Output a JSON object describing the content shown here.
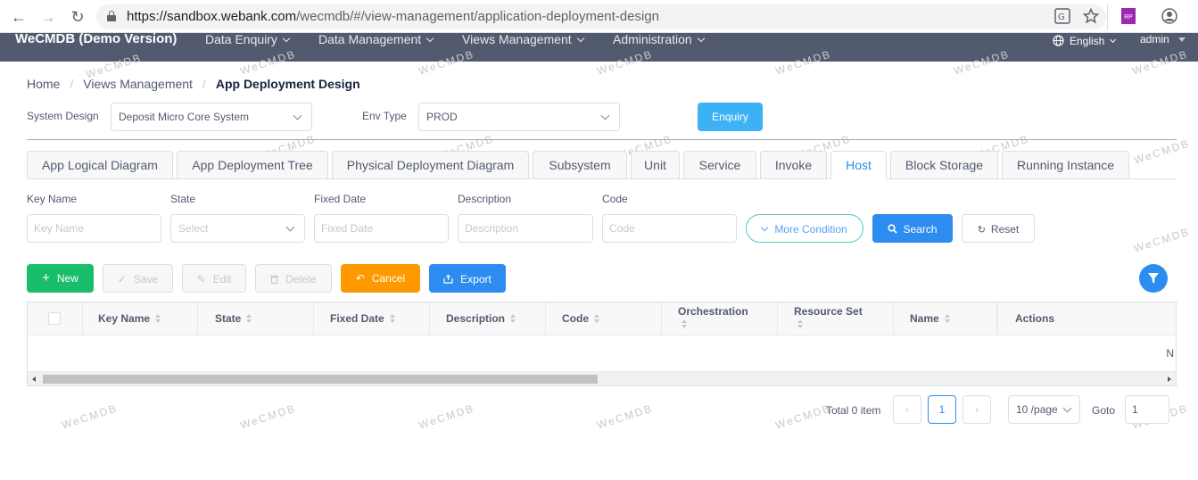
{
  "browser": {
    "url_host": "https://sandbox.webank.com",
    "url_path": "/wecmdb/#/view-management/application-deployment-design",
    "ext_badge": "RP"
  },
  "header": {
    "brand": "WeCMDB (Demo Version)",
    "menus": [
      "Data Enquiry",
      "Data Management",
      "Views Management",
      "Administration"
    ],
    "language": "English",
    "user": "admin"
  },
  "watermark": "WeCMDB",
  "breadcrumb": {
    "home": "Home",
    "parent": "Views Management",
    "current": "App Deployment Design",
    "separator": "/"
  },
  "system_design": {
    "label": "System Design",
    "value": "Deposit Micro Core System"
  },
  "env_type": {
    "label": "Env Type",
    "value": "PROD"
  },
  "enquiry_label": "Enquiry",
  "tabs": [
    "App Logical Diagram",
    "App Deployment Tree",
    "Physical Deployment Diagram",
    "Subsystem",
    "Unit",
    "Service",
    "Invoke",
    "Host",
    "Block Storage",
    "Running Instance"
  ],
  "active_tab": "Host",
  "filters": [
    {
      "label": "Key Name",
      "placeholder": "Key Name"
    },
    {
      "label": "State",
      "placeholder": "Select"
    },
    {
      "label": "Fixed Date",
      "placeholder": "Fixed Date"
    },
    {
      "label": "Description",
      "placeholder": "Description"
    },
    {
      "label": "Code",
      "placeholder": "Code"
    }
  ],
  "filter_buttons": {
    "more": "More Condition",
    "search": "Search",
    "reset": "Reset"
  },
  "toolbar": {
    "new": "New",
    "save": "Save",
    "edit": "Edit",
    "delete": "Delete",
    "cancel": "Cancel",
    "export": "Export"
  },
  "table": {
    "columns": [
      "Key Name",
      "State",
      "Fixed Date",
      "Description",
      "Code",
      "Orchestration",
      "Resource Set",
      "Name",
      "Actions"
    ],
    "empty_text": "N"
  },
  "pagination": {
    "total": "Total 0 item",
    "current_page": "1",
    "page_size": "10 /page",
    "goto_label": "Goto",
    "goto_value": "1"
  },
  "colors": {
    "header_bg": "#515a6e",
    "primary": "#2d8cf0",
    "success": "#19be6b",
    "warning": "#ff9900",
    "enquiry": "#3cb2f5"
  }
}
